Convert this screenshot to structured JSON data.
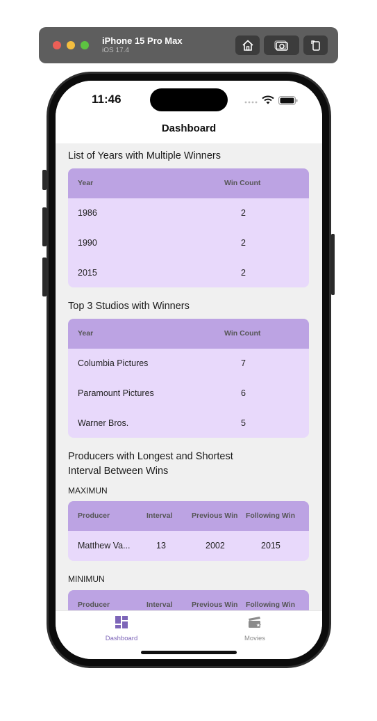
{
  "simulator": {
    "device": "iPhone 15 Pro Max",
    "os": "iOS 17.4"
  },
  "status_bar": {
    "time": "11:46"
  },
  "nav": {
    "title": "Dashboard"
  },
  "multiple_winners": {
    "title": "List of Years with Multiple Winners",
    "columns": [
      "Year",
      "Win Count"
    ],
    "rows": [
      {
        "year": "1986",
        "count": "2"
      },
      {
        "year": "1990",
        "count": "2"
      },
      {
        "year": "2015",
        "count": "2"
      }
    ]
  },
  "top_studios": {
    "title": "Top 3 Studios with Winners",
    "columns": [
      "Year",
      "Win Count"
    ],
    "rows": [
      {
        "name": "Columbia Pictures",
        "count": "7"
      },
      {
        "name": "Paramount Pictures",
        "count": "6"
      },
      {
        "name": "Warner Bros.",
        "count": "5"
      }
    ]
  },
  "intervals": {
    "title_line1": "Producers with Longest and Shortest",
    "title_line2": "Interval Between Wins",
    "max_label": "MAXIMUN",
    "min_label": "MINIMUN",
    "columns": [
      "Producer",
      "Interval",
      "Previous Win",
      "Following Win"
    ],
    "max_row": {
      "producer": "Matthew Va...",
      "interval": "13",
      "previous": "2002",
      "following": "2015"
    }
  },
  "tabs": [
    {
      "label": "Dashboard",
      "icon": "dashboard-icon",
      "active": true
    },
    {
      "label": "Movies",
      "icon": "movies-icon",
      "active": false
    }
  ],
  "colors": {
    "header": "#bca3e3",
    "row_bg": "#e8d9fb",
    "accent": "#7d65b8"
  }
}
